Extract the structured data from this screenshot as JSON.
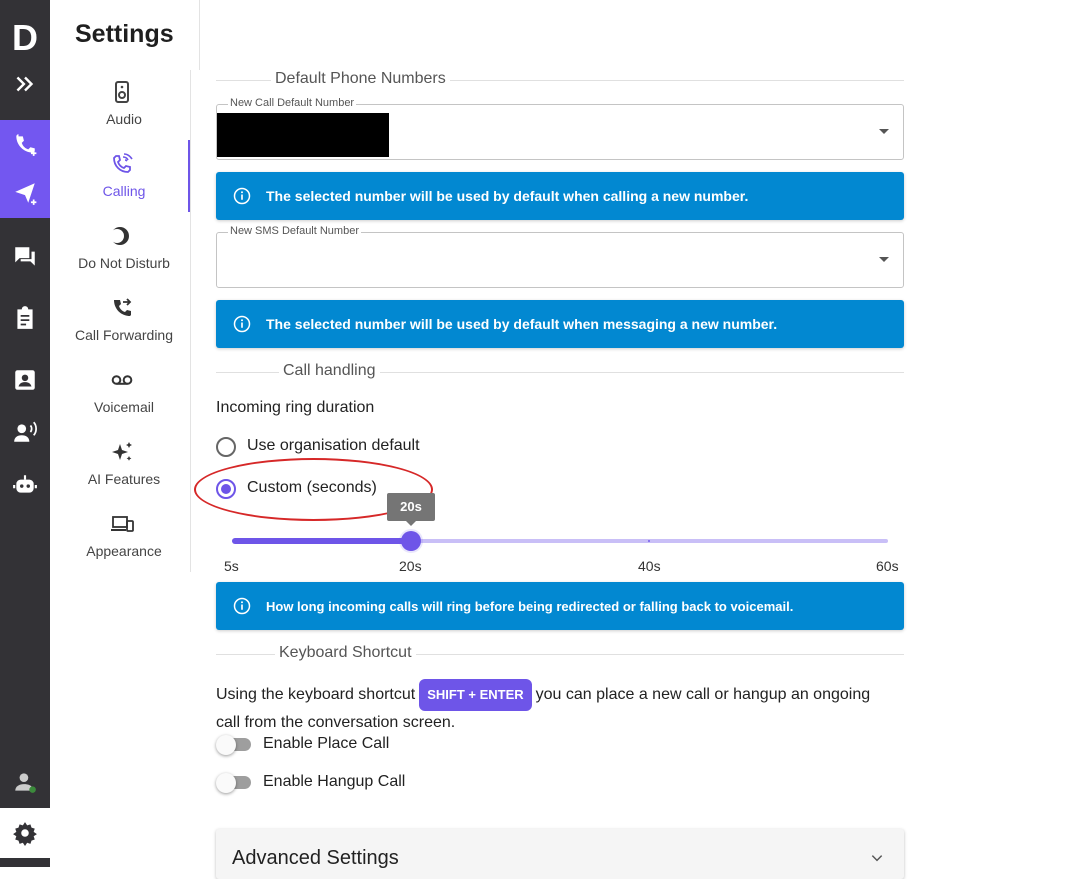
{
  "app": {
    "logo": "D"
  },
  "rail": {
    "items": [
      {
        "icon": "expand-icon"
      },
      {
        "icon": "add-call-icon"
      },
      {
        "icon": "send-message-icon"
      },
      {
        "icon": "conversations-icon"
      },
      {
        "icon": "clipboard-icon"
      },
      {
        "icon": "contacts-icon"
      },
      {
        "icon": "speaking-user-icon"
      },
      {
        "icon": "robot-icon"
      },
      {
        "icon": "user-status-icon"
      },
      {
        "icon": "gear-icon"
      }
    ],
    "accent": "#7357f0"
  },
  "settings": {
    "title": "Settings",
    "nav": [
      {
        "label": "Audio",
        "icon": "speaker-icon"
      },
      {
        "label": "Calling",
        "icon": "wifi-call-icon",
        "active": true
      },
      {
        "label": "Do Not Disturb",
        "icon": "moon-icon"
      },
      {
        "label": "Call Forwarding",
        "icon": "forward-call-icon"
      },
      {
        "label": "Voicemail",
        "icon": "voicemail-icon"
      },
      {
        "label": "AI Features",
        "icon": "sparkle-icon"
      },
      {
        "label": "Appearance",
        "icon": "devices-icon"
      }
    ]
  },
  "phone_numbers": {
    "section_title": "Default Phone Numbers",
    "call_label": "New Call Default Number",
    "call_value": "",
    "call_info": "The selected number will be used by default when calling a new number.",
    "sms_label": "New SMS Default Number",
    "sms_value": "",
    "sms_info": "The selected number will be used by default when messaging a new number."
  },
  "call_handling": {
    "section_title": "Call handling",
    "ring_label": "Incoming ring duration",
    "options": [
      {
        "label": "Use organisation default",
        "selected": false
      },
      {
        "label": "Custom (seconds)",
        "selected": true
      }
    ],
    "slider": {
      "min": 5,
      "max": 60,
      "value": 20,
      "tooltip": "20s",
      "marks": [
        {
          "value": 5,
          "label": "5s"
        },
        {
          "value": 20,
          "label": "20s"
        },
        {
          "value": 40,
          "label": "40s"
        },
        {
          "value": 60,
          "label": "60s"
        }
      ]
    },
    "info": "How long incoming calls will ring before being redirected or falling back to voicemail."
  },
  "keyboard": {
    "section_title": "Keyboard Shortcut",
    "text_before": "Using the keyboard shortcut",
    "shortcut": "SHIFT + ENTER",
    "text_after": "you can place a new call or hangup an ongoing",
    "text_line2": "call from the conversation screen.",
    "toggles": [
      {
        "label": "Enable Place Call",
        "on": false
      },
      {
        "label": "Enable Hangup Call",
        "on": false
      }
    ]
  },
  "advanced": {
    "title": "Advanced Settings"
  },
  "colors": {
    "accent": "#6e55e8",
    "info": "#0288d1",
    "rail": "#333236",
    "annotation": "#d62828"
  }
}
